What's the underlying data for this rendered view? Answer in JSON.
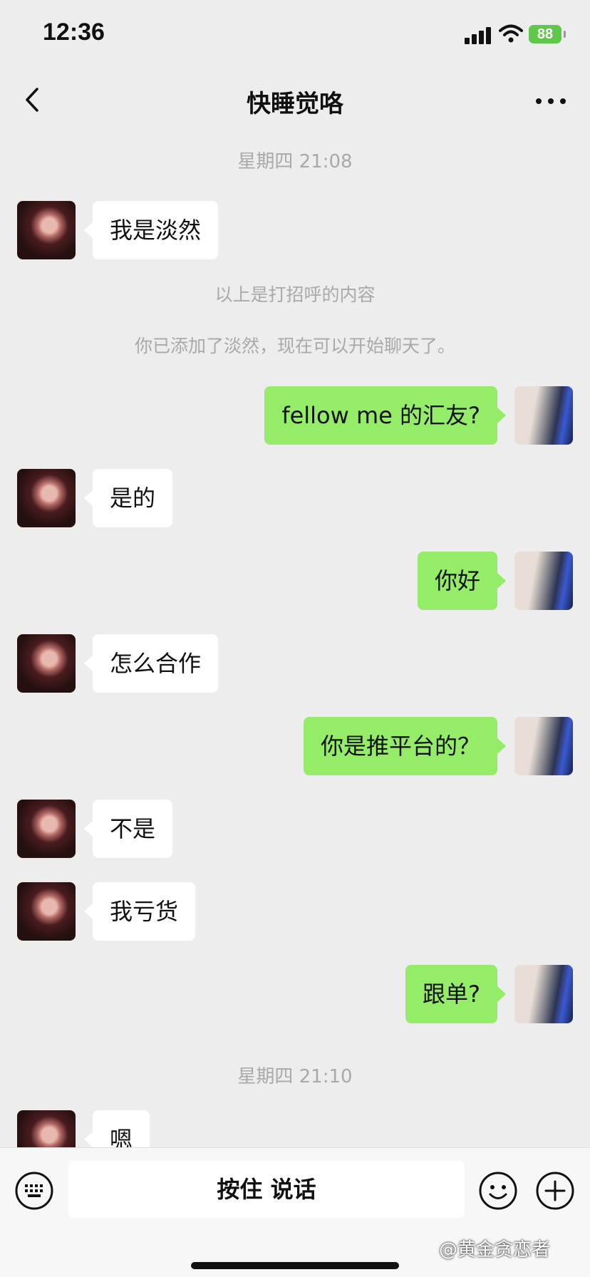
{
  "status_bar": {
    "time": "12:36",
    "battery": "88"
  },
  "nav": {
    "title": "快睡觉咯",
    "back_icon": "chevron-left-icon",
    "more_icon": "more-icon"
  },
  "chat": {
    "timestamps": [
      "星期四 21:08",
      "星期四 21:10"
    ],
    "system_messages": [
      "以上是打招呼的内容",
      "你已添加了淡然，现在可以开始聊天了。"
    ],
    "messages": [
      {
        "from": "other",
        "text": "我是淡然"
      },
      {
        "from": "me",
        "text": "fellow me 的汇友?"
      },
      {
        "from": "other",
        "text": "是的"
      },
      {
        "from": "me",
        "text": "你好"
      },
      {
        "from": "other",
        "text": "怎么合作"
      },
      {
        "from": "me",
        "text": "你是推平台的？"
      },
      {
        "from": "other",
        "text": "不是"
      },
      {
        "from": "other",
        "text": "我亏货"
      },
      {
        "from": "me",
        "text": "跟单?"
      },
      {
        "from": "other",
        "text": "嗯"
      }
    ]
  },
  "toolbar": {
    "voice_label": "按住 说话",
    "keyboard_icon": "keyboard-icon",
    "emoji_icon": "emoji-icon",
    "plus_icon": "plus-circle-icon"
  },
  "watermark": "@黄金贪恋者",
  "colors": {
    "background": "#ededed",
    "bubble_self": "#95ec69",
    "bubble_other": "#ffffff",
    "battery": "#5fc74a"
  }
}
